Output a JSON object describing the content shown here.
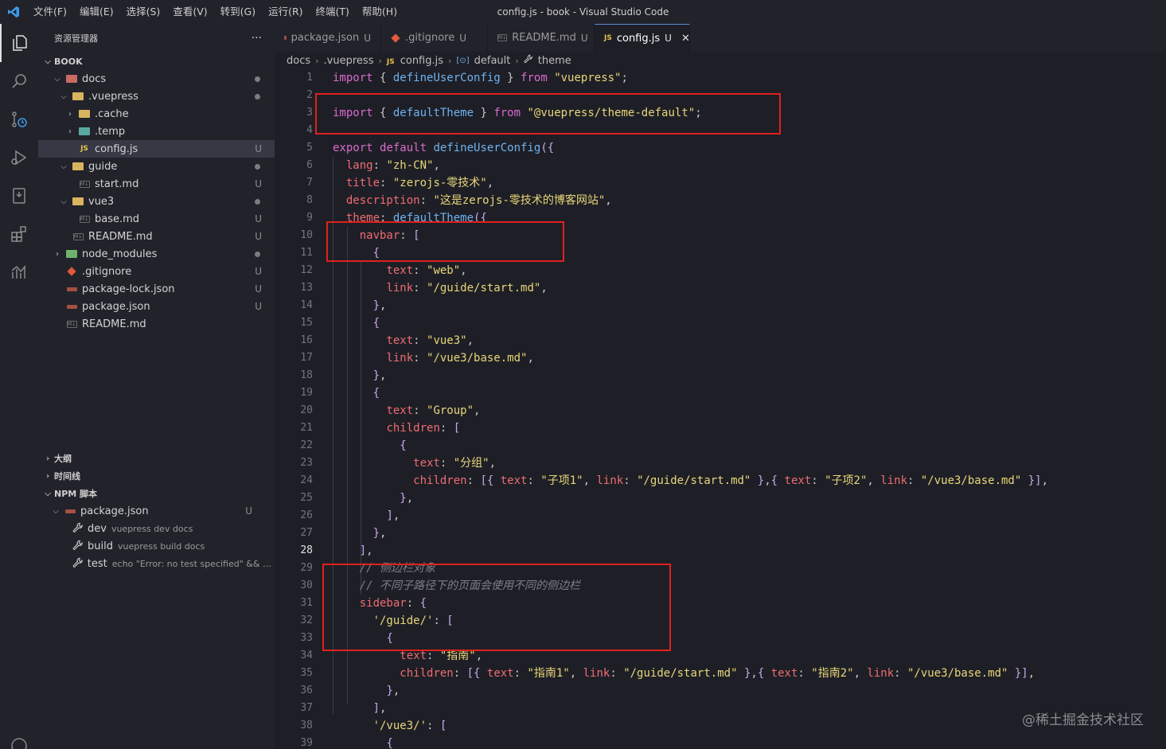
{
  "window": {
    "title": "config.js - book - Visual Studio Code"
  },
  "menu": [
    "文件(F)",
    "编辑(E)",
    "选择(S)",
    "查看(V)",
    "转到(G)",
    "运行(R)",
    "终端(T)",
    "帮助(H)"
  ],
  "sidebar": {
    "header": "资源管理器",
    "more": "···",
    "root": "BOOK",
    "tree": [
      {
        "label": "docs",
        "indent": 1,
        "type": "folder-red",
        "chev": "v",
        "status": "dot"
      },
      {
        "label": ".vuepress",
        "indent": 2,
        "type": "folder",
        "chev": "v",
        "status": "dot"
      },
      {
        "label": ".cache",
        "indent": 3,
        "type": "folder",
        "chev": ">",
        "status": ""
      },
      {
        "label": ".temp",
        "indent": 3,
        "type": "folder-teal",
        "chev": ">",
        "status": ""
      },
      {
        "label": "config.js",
        "indent": 3,
        "type": "js",
        "chev": "",
        "status": "U",
        "selected": true
      },
      {
        "label": "guide",
        "indent": 2,
        "type": "folder",
        "chev": "v",
        "status": "dot"
      },
      {
        "label": "start.md",
        "indent": 3,
        "type": "md",
        "chev": "",
        "status": "U"
      },
      {
        "label": "vue3",
        "indent": 2,
        "type": "folder",
        "chev": "v",
        "status": "dot"
      },
      {
        "label": "base.md",
        "indent": 3,
        "type": "md",
        "chev": "",
        "status": "U"
      },
      {
        "label": "README.md",
        "indent": 2,
        "type": "md",
        "chev": "",
        "status": "U"
      },
      {
        "label": "node_modules",
        "indent": 1,
        "type": "folder-green",
        "chev": ">",
        "status": "dot"
      },
      {
        "label": ".gitignore",
        "indent": 1,
        "type": "git",
        "chev": "",
        "status": "U"
      },
      {
        "label": "package-lock.json",
        "indent": 1,
        "type": "json",
        "chev": "",
        "status": "U"
      },
      {
        "label": "package.json",
        "indent": 1,
        "type": "json",
        "chev": "",
        "status": "U"
      },
      {
        "label": "README.md",
        "indent": 1,
        "type": "md",
        "chev": "",
        "status": ""
      }
    ],
    "outline": "大纲",
    "timeline": "时间线",
    "npm": "NPM 脚本",
    "npm_pkg": "package.json",
    "npm_pkg_status": "U",
    "scripts": [
      {
        "name": "dev",
        "cmd": "vuepress dev docs"
      },
      {
        "name": "build",
        "cmd": "vuepress build docs"
      },
      {
        "name": "test",
        "cmd": "echo \"Error: no test specified\" && e..."
      }
    ]
  },
  "tabs": [
    {
      "label": "package.json",
      "status": "U",
      "icon": "json"
    },
    {
      "label": ".gitignore",
      "status": "U",
      "icon": "git"
    },
    {
      "label": "README.md",
      "status": "U",
      "icon": "md"
    },
    {
      "label": "config.js",
      "status": "U",
      "icon": "js",
      "active": true
    }
  ],
  "breadcrumb": [
    "docs",
    ".vuepress",
    "config.js",
    "default",
    "theme"
  ],
  "code": {
    "current_line": 28,
    "lines": [
      [
        [
          "kw",
          "import"
        ],
        [
          "pn",
          " { "
        ],
        [
          "fn",
          "defineUserConfig"
        ],
        [
          "pn",
          " } "
        ],
        [
          "kw",
          "from"
        ],
        [
          "pn",
          " "
        ],
        [
          "str",
          "\"vuepress\""
        ],
        [
          "pn",
          ";"
        ]
      ],
      [],
      [
        [
          "kw",
          "import"
        ],
        [
          "pn",
          " { "
        ],
        [
          "fn",
          "defaultTheme"
        ],
        [
          "pn",
          " } "
        ],
        [
          "kw",
          "from"
        ],
        [
          "pn",
          " "
        ],
        [
          "str",
          "\"@vuepress/theme-default\""
        ],
        [
          "pn",
          ";"
        ]
      ],
      [],
      [
        [
          "kw",
          "export"
        ],
        [
          "pn",
          " "
        ],
        [
          "kw",
          "default"
        ],
        [
          "pn",
          " "
        ],
        [
          "fn",
          "defineUserConfig"
        ],
        [
          "br",
          "({"
        ]
      ],
      [
        [
          "pn",
          "  "
        ],
        [
          "prop",
          "lang"
        ],
        [
          "pn",
          ": "
        ],
        [
          "str",
          "\"zh-CN\""
        ],
        [
          "pn",
          ","
        ]
      ],
      [
        [
          "pn",
          "  "
        ],
        [
          "prop",
          "title"
        ],
        [
          "pn",
          ": "
        ],
        [
          "str",
          "\"zerojs-零技术\""
        ],
        [
          "pn",
          ","
        ]
      ],
      [
        [
          "pn",
          "  "
        ],
        [
          "prop",
          "description"
        ],
        [
          "pn",
          ": "
        ],
        [
          "str",
          "\"这是zerojs-零技术的博客网站\""
        ],
        [
          "pn",
          ","
        ]
      ],
      [
        [
          "pn",
          "  "
        ],
        [
          "prop",
          "theme"
        ],
        [
          "pn",
          ": "
        ],
        [
          "fn",
          "defaultTheme"
        ],
        [
          "br",
          "({"
        ]
      ],
      [
        [
          "pn",
          "    "
        ],
        [
          "prop",
          "navbar"
        ],
        [
          "pn",
          ": "
        ],
        [
          "br",
          "["
        ]
      ],
      [
        [
          "pn",
          "      "
        ],
        [
          "br",
          "{"
        ]
      ],
      [
        [
          "pn",
          "        "
        ],
        [
          "prop",
          "text"
        ],
        [
          "pn",
          ": "
        ],
        [
          "str",
          "\"web\""
        ],
        [
          "pn",
          ","
        ]
      ],
      [
        [
          "pn",
          "        "
        ],
        [
          "prop",
          "link"
        ],
        [
          "pn",
          ": "
        ],
        [
          "str",
          "\"/guide/start.md\""
        ],
        [
          "pn",
          ","
        ]
      ],
      [
        [
          "pn",
          "      "
        ],
        [
          "br",
          "}"
        ],
        [
          "pn",
          ","
        ]
      ],
      [
        [
          "pn",
          "      "
        ],
        [
          "br",
          "{"
        ]
      ],
      [
        [
          "pn",
          "        "
        ],
        [
          "prop",
          "text"
        ],
        [
          "pn",
          ": "
        ],
        [
          "str",
          "\"vue3\""
        ],
        [
          "pn",
          ","
        ]
      ],
      [
        [
          "pn",
          "        "
        ],
        [
          "prop",
          "link"
        ],
        [
          "pn",
          ": "
        ],
        [
          "str",
          "\"/vue3/base.md\""
        ],
        [
          "pn",
          ","
        ]
      ],
      [
        [
          "pn",
          "      "
        ],
        [
          "br",
          "}"
        ],
        [
          "pn",
          ","
        ]
      ],
      [
        [
          "pn",
          "      "
        ],
        [
          "br",
          "{"
        ]
      ],
      [
        [
          "pn",
          "        "
        ],
        [
          "prop",
          "text"
        ],
        [
          "pn",
          ": "
        ],
        [
          "str",
          "\"Group\""
        ],
        [
          "pn",
          ","
        ]
      ],
      [
        [
          "pn",
          "        "
        ],
        [
          "prop",
          "children"
        ],
        [
          "pn",
          ": "
        ],
        [
          "br",
          "["
        ]
      ],
      [
        [
          "pn",
          "          "
        ],
        [
          "br",
          "{"
        ]
      ],
      [
        [
          "pn",
          "            "
        ],
        [
          "prop",
          "text"
        ],
        [
          "pn",
          ": "
        ],
        [
          "str",
          "\"分组\""
        ],
        [
          "pn",
          ","
        ]
      ],
      [
        [
          "pn",
          "            "
        ],
        [
          "prop",
          "children"
        ],
        [
          "pn",
          ": "
        ],
        [
          "br",
          "[{"
        ],
        [
          "pn",
          " "
        ],
        [
          "prop",
          "text"
        ],
        [
          "pn",
          ": "
        ],
        [
          "str",
          "\"子项1\""
        ],
        [
          "pn",
          ", "
        ],
        [
          "prop",
          "link"
        ],
        [
          "pn",
          ": "
        ],
        [
          "str",
          "\"/guide/start.md\""
        ],
        [
          "pn",
          " "
        ],
        [
          "br",
          "}"
        ],
        [
          "pn",
          ","
        ],
        [
          "br",
          "{"
        ],
        [
          "pn",
          " "
        ],
        [
          "prop",
          "text"
        ],
        [
          "pn",
          ": "
        ],
        [
          "str",
          "\"子项2\""
        ],
        [
          "pn",
          ", "
        ],
        [
          "prop",
          "link"
        ],
        [
          "pn",
          ": "
        ],
        [
          "str",
          "\"/vue3/base.md\""
        ],
        [
          "pn",
          " "
        ],
        [
          "br",
          "}]"
        ],
        [
          "pn",
          ","
        ]
      ],
      [
        [
          "pn",
          "          "
        ],
        [
          "br",
          "}"
        ],
        [
          "pn",
          ","
        ]
      ],
      [
        [
          "pn",
          "        "
        ],
        [
          "br",
          "]"
        ],
        [
          "pn",
          ","
        ]
      ],
      [
        [
          "pn",
          "      "
        ],
        [
          "br",
          "}"
        ],
        [
          "pn",
          ","
        ]
      ],
      [
        [
          "pn",
          "    "
        ],
        [
          "br",
          "]"
        ],
        [
          "pn",
          ","
        ]
      ],
      [
        [
          "pn",
          "    "
        ],
        [
          "cmt",
          "// 侧边栏对象"
        ]
      ],
      [
        [
          "pn",
          "    "
        ],
        [
          "cmt",
          "// 不同子路径下的页面会使用不同的侧边栏"
        ]
      ],
      [
        [
          "pn",
          "    "
        ],
        [
          "prop",
          "sidebar"
        ],
        [
          "pn",
          ": "
        ],
        [
          "br",
          "{"
        ]
      ],
      [
        [
          "pn",
          "      "
        ],
        [
          "str",
          "'/guide/'"
        ],
        [
          "pn",
          ": "
        ],
        [
          "br",
          "["
        ]
      ],
      [
        [
          "pn",
          "        "
        ],
        [
          "br",
          "{"
        ]
      ],
      [
        [
          "pn",
          "          "
        ],
        [
          "prop",
          "text"
        ],
        [
          "pn",
          ": "
        ],
        [
          "str",
          "\"指南\""
        ],
        [
          "pn",
          ","
        ]
      ],
      [
        [
          "pn",
          "          "
        ],
        [
          "prop",
          "children"
        ],
        [
          "pn",
          ": "
        ],
        [
          "br",
          "[{"
        ],
        [
          "pn",
          " "
        ],
        [
          "prop",
          "text"
        ],
        [
          "pn",
          ": "
        ],
        [
          "str",
          "\"指南1\""
        ],
        [
          "pn",
          ", "
        ],
        [
          "prop",
          "link"
        ],
        [
          "pn",
          ": "
        ],
        [
          "str",
          "\"/guide/start.md\""
        ],
        [
          "pn",
          " "
        ],
        [
          "br",
          "}"
        ],
        [
          "pn",
          ","
        ],
        [
          "br",
          "{"
        ],
        [
          "pn",
          " "
        ],
        [
          "prop",
          "text"
        ],
        [
          "pn",
          ": "
        ],
        [
          "str",
          "\"指南2\""
        ],
        [
          "pn",
          ", "
        ],
        [
          "prop",
          "link"
        ],
        [
          "pn",
          ": "
        ],
        [
          "str",
          "\"/vue3/base.md\""
        ],
        [
          "pn",
          " "
        ],
        [
          "br",
          "}]"
        ],
        [
          "pn",
          ","
        ]
      ],
      [
        [
          "pn",
          "        "
        ],
        [
          "br",
          "}"
        ],
        [
          "pn",
          ","
        ]
      ],
      [
        [
          "pn",
          "      "
        ],
        [
          "br",
          "]"
        ],
        [
          "pn",
          ","
        ]
      ],
      [
        [
          "pn",
          "      "
        ],
        [
          "str",
          "'/vue3/'"
        ],
        [
          "pn",
          ": "
        ],
        [
          "br",
          "["
        ]
      ],
      [
        [
          "pn",
          "        "
        ],
        [
          "br",
          "{"
        ]
      ]
    ]
  },
  "watermark": "@稀土掘金技术社区",
  "colors": {
    "highlight": "#e0201e",
    "accent": "#5a8fd6",
    "js": "#e8c04a"
  }
}
